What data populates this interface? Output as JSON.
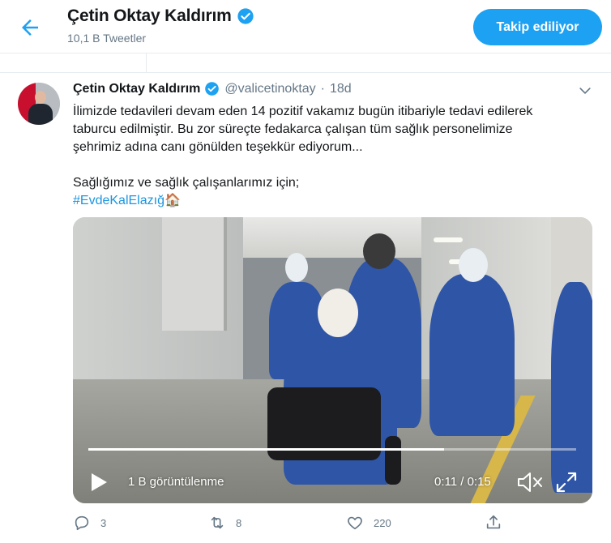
{
  "header": {
    "back_icon": "arrow-left-icon",
    "title": "Çetin Oktay Kaldırım",
    "subtitle": "10,1 B Tweetler",
    "follow_button": "Takip ediliyor",
    "accent": "#1da1f2"
  },
  "tweet": {
    "author_name": "Çetin Oktay Kaldırım",
    "handle": "@valicetinoktay",
    "separator": "·",
    "time": "18d",
    "text_lines": [
      "İlimizde tedavileri devam eden 14 pozitif vakamız bugün itibariyle tedavi edilerek",
      "taburcu edilmiştir. Bu zor süreçte fedakarca çalışan tüm sağlık personelimize",
      "şehrimiz adına canı gönülden teşekkür ediyorum..."
    ],
    "line2": "Sağlığımız ve sağlık çalışanlarımız için;",
    "hashtag": "#EvdeKalElazığ",
    "emoji": "🏠",
    "video": {
      "views": "1 B görüntülenme",
      "time": "0:11 / 0:15",
      "progress": 0.73
    },
    "actions": {
      "replies": "3",
      "retweets": "8",
      "likes": "220"
    }
  }
}
